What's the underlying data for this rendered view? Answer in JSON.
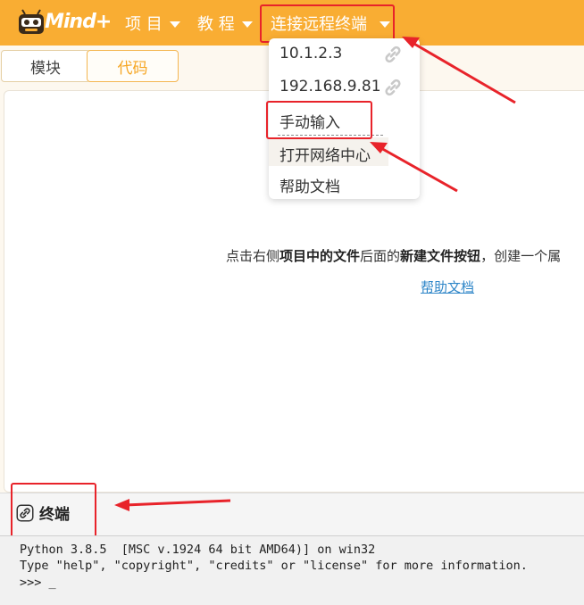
{
  "app": {
    "logo_text": "Mind+"
  },
  "menubar": {
    "project": "项 目",
    "tutorial": "教 程",
    "remote": "连接远程终端"
  },
  "tabs": {
    "blocks": "模块",
    "code": "代码"
  },
  "dropdown": {
    "items": [
      {
        "label": "10.1.2.3",
        "icon": "link-icon"
      },
      {
        "label": "192.168.9.81",
        "icon": "link-icon"
      },
      {
        "label": "手动输入"
      },
      {
        "label": "打开网络中心"
      },
      {
        "label": "帮助文档"
      }
    ]
  },
  "editor": {
    "empty_parts": [
      "点击右侧",
      "项目中的文件",
      "后面的",
      "新建文件按钮",
      "，创建一个属"
    ],
    "help_link": "帮助文档"
  },
  "terminal": {
    "tab_label": "终端",
    "icon": "link-icon",
    "lines": [
      "Python 3.8.5  [MSC v.1924 64 bit AMD64)] on win32",
      "Type \"help\", \"copyright\", \"credits\" or \"license\" for more information.",
      ">>> _"
    ]
  },
  "colors": {
    "accent": "#f9ad33",
    "highlight": "#e8232a",
    "link": "#2e86c8"
  }
}
